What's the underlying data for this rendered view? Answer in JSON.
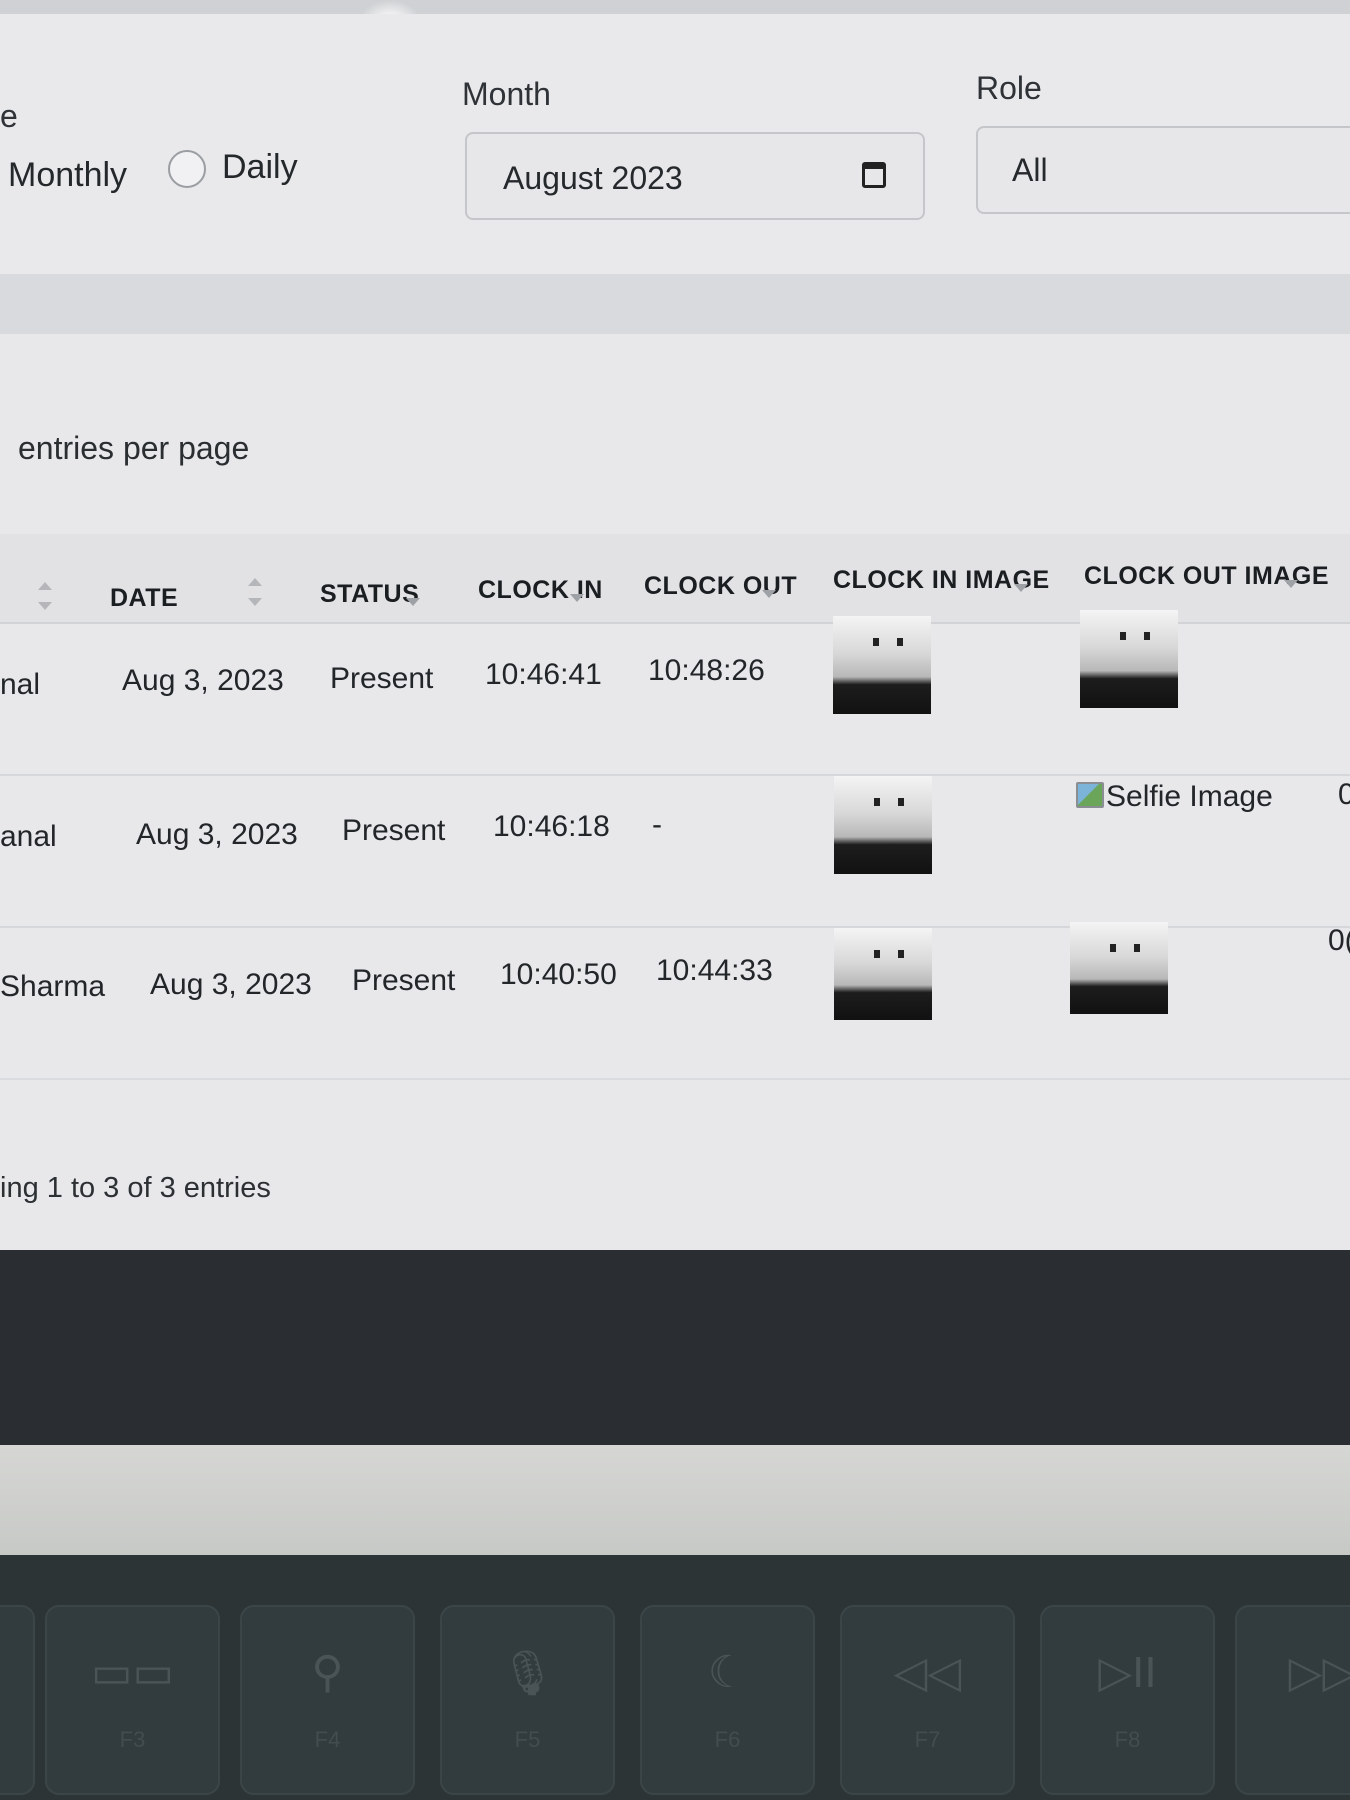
{
  "filters": {
    "type_label_fragment": "e",
    "radio_monthly": "Monthly",
    "radio_daily": "Daily",
    "month_label": "Month",
    "month_value": "August 2023",
    "role_label": "Role",
    "role_value": "All"
  },
  "table": {
    "entries_label": "entries per page",
    "headers": {
      "date": "DATE",
      "status": "STATUS",
      "clock_in": "CLOCK IN",
      "clock_out": "CLOCK OUT",
      "clock_in_image": "CLOCK IN IMAGE",
      "clock_out_image": "CLOCK OUT IMAGE"
    },
    "rows": [
      {
        "name": "nal",
        "date": "Aug 3, 2023",
        "status": "Present",
        "clock_in": "10:46:41",
        "clock_out": "10:48:26",
        "clock_out_image_alt": ""
      },
      {
        "name": "anal",
        "date": "Aug 3, 2023",
        "status": "Present",
        "clock_in": "10:46:18",
        "clock_out": "-",
        "clock_out_image_alt": "Selfie Image",
        "extra": "0"
      },
      {
        "name": "Sharma",
        "date": "Aug 3, 2023",
        "status": "Present",
        "clock_in": "10:40:50",
        "clock_out": "10:44:33",
        "clock_out_image_alt": "",
        "extra": "0("
      }
    ],
    "footer": "ing 1 to 3 of 3 entries"
  },
  "keyboard": {
    "keys": [
      {
        "glyph": "",
        "sub": ""
      },
      {
        "glyph": "▭▭",
        "sub": "F3"
      },
      {
        "glyph": "⚲",
        "sub": "F4"
      },
      {
        "glyph": "🎙",
        "sub": "F5"
      },
      {
        "glyph": "☾",
        "sub": "F6"
      },
      {
        "glyph": "◁◁",
        "sub": "F7"
      },
      {
        "glyph": "▷II",
        "sub": "F8"
      },
      {
        "glyph": "▷▷",
        "sub": ""
      }
    ]
  }
}
